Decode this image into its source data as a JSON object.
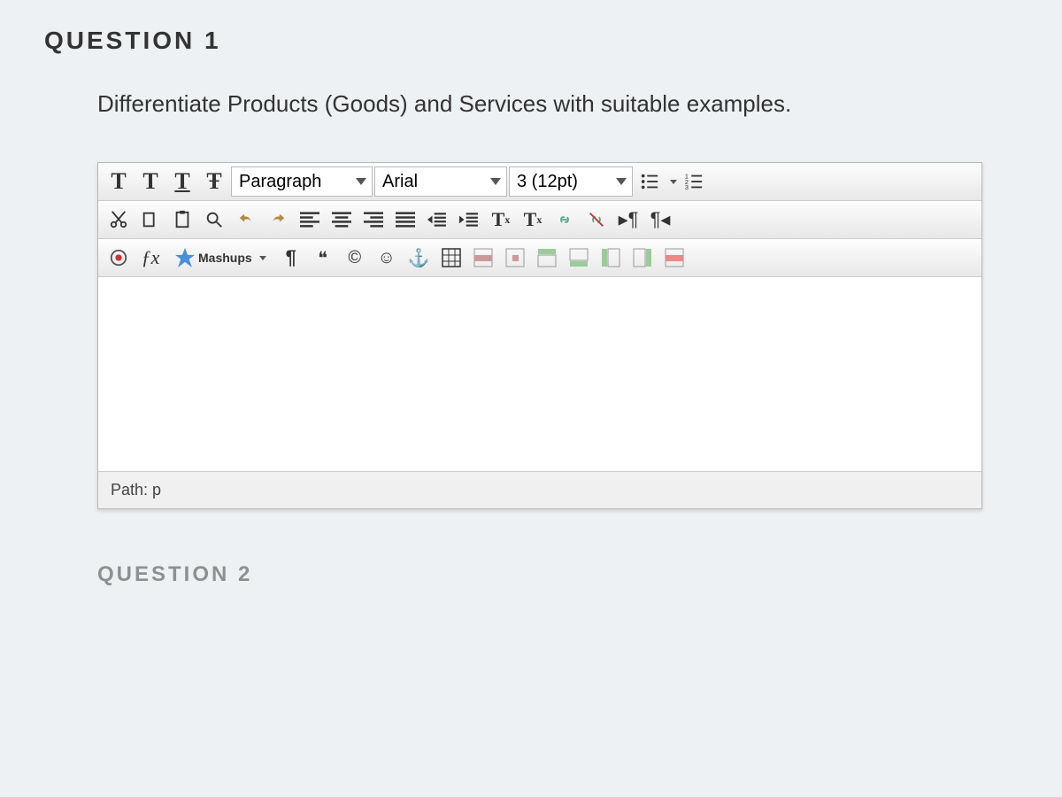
{
  "question1": {
    "header": "QUESTION 1",
    "prompt": "Differentiate Products (Goods) and Services with suitable examples."
  },
  "toolbar": {
    "row1": {
      "t1": "T",
      "t2": "T",
      "t3": "T",
      "t4": "Ŧ",
      "format_sel": "Paragraph",
      "font_sel": "Arial",
      "size_sel": "3 (12pt)"
    },
    "row2": {
      "superscript": "T",
      "superscript_x": "x",
      "subscript": "T",
      "subscript_x": "x",
      "para_ltr": "¶",
      "para_rtl": "¶"
    },
    "row3": {
      "fx": "ƒx",
      "mashups": "Mashups",
      "pilcrow": "¶",
      "quote": "❝",
      "copyright": "©",
      "smiley": "☺",
      "anchor": "⚓"
    }
  },
  "path": {
    "label": "Path:",
    "value": "p"
  },
  "question2": {
    "header": "QUESTION 2"
  }
}
